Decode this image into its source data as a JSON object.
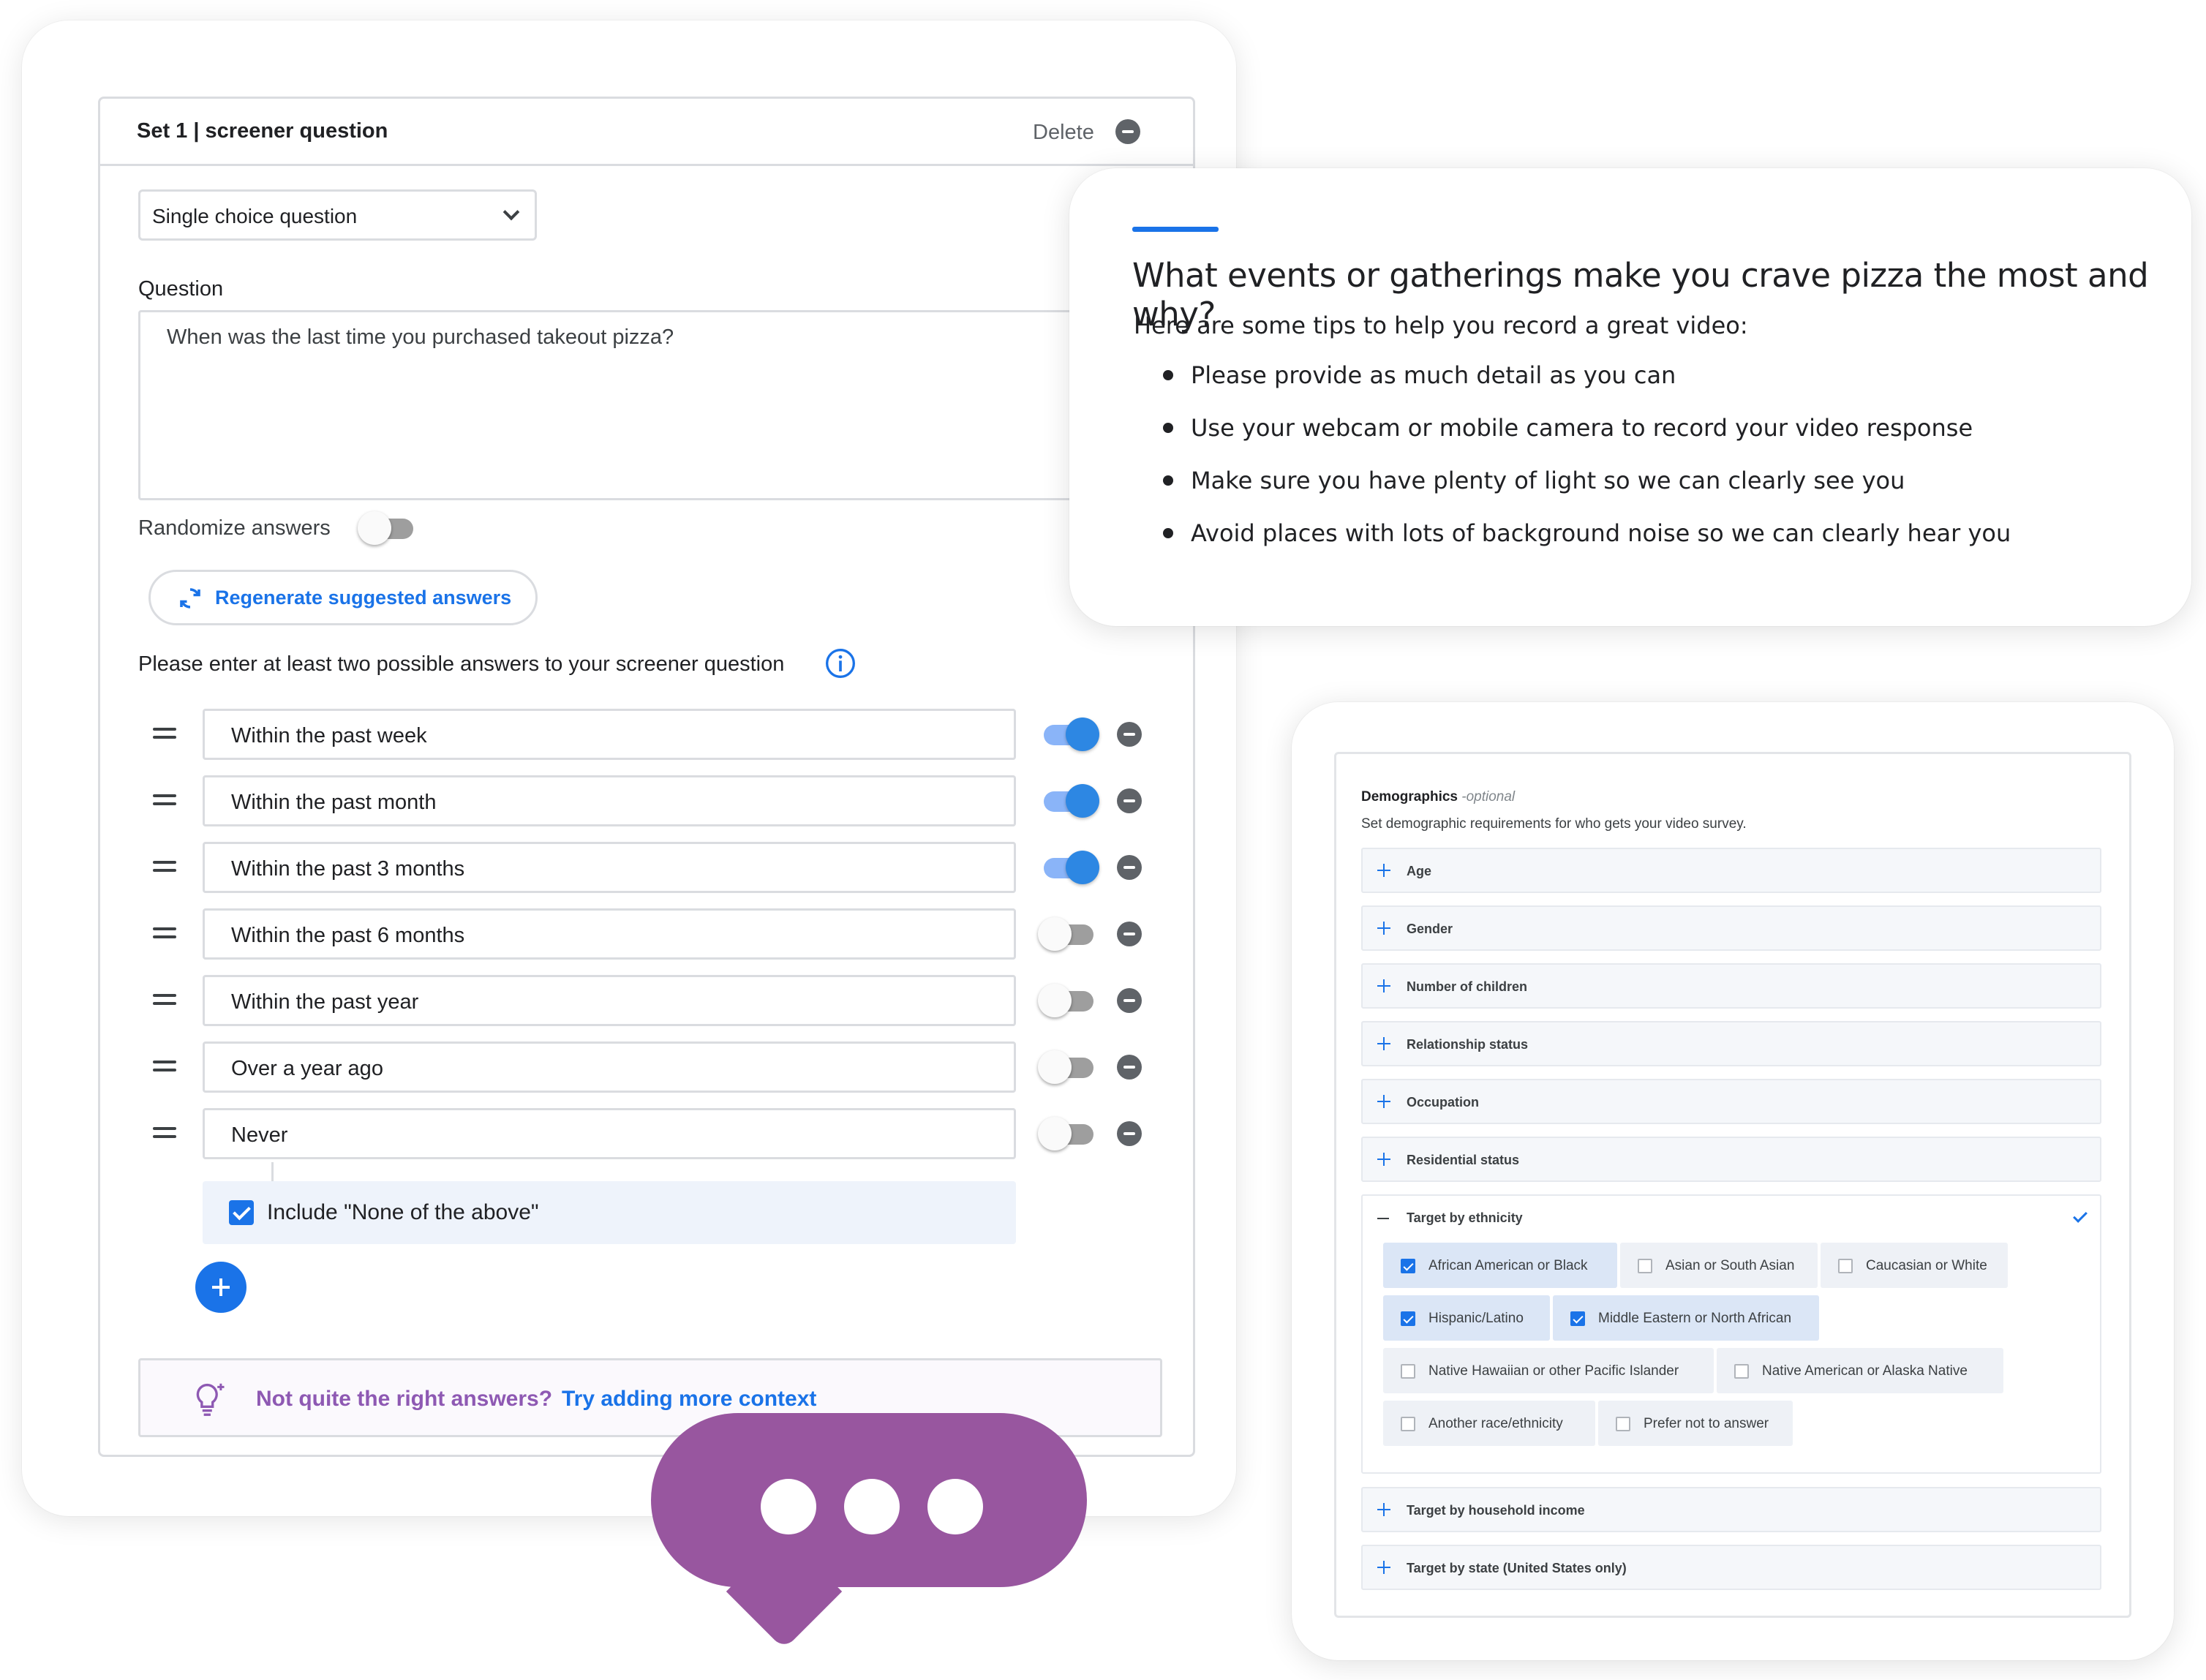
{
  "screener": {
    "set_title": "Set 1 | screener question",
    "delete_label": "Delete",
    "question_type": "Single choice question",
    "question_label": "Question",
    "question_text": "When was the last time you purchased takeout pizza?",
    "randomize_label": "Randomize answers",
    "randomize_on": false,
    "regenerate_label": "Regenerate suggested answers",
    "instruction": "Please enter at least two possible answers to your screener question",
    "answers": [
      {
        "text": "Within the past week",
        "enabled": true
      },
      {
        "text": "Within the past month",
        "enabled": true
      },
      {
        "text": "Within the past 3 months",
        "enabled": true
      },
      {
        "text": "Within the past 6 months",
        "enabled": false
      },
      {
        "text": "Within the past year",
        "enabled": false
      },
      {
        "text": "Over a year ago",
        "enabled": false
      },
      {
        "text": "Never",
        "enabled": false
      }
    ],
    "none_of_above_label": "Include \"None of the above\"",
    "none_of_above_checked": true,
    "context_question": "Not quite the right answers?",
    "context_link": "Try adding more context"
  },
  "tips": {
    "question": "What events or gatherings make you crave pizza the most and why?",
    "intro": "Here are some tips to help you record a great video:",
    "items": [
      "Please provide as much detail as you can",
      "Use your webcam or mobile camera to record your video response",
      "Make sure you have plenty of light so we can clearly see you",
      "Avoid places with lots of background noise so we can clearly hear you"
    ]
  },
  "demographics": {
    "title": "Demographics",
    "optional": "-optional",
    "subtitle": "Set demographic requirements for who gets your video survey.",
    "sections_top": [
      "Age",
      "Gender",
      "Number of children",
      "Relationship status",
      "Occupation",
      "Residential status"
    ],
    "ethnicity_label": "Target by ethnicity",
    "ethnicity_options": [
      {
        "label": "African American or Black",
        "checked": true
      },
      {
        "label": "Asian or South Asian",
        "checked": false
      },
      {
        "label": "Caucasian or White",
        "checked": false
      },
      {
        "label": "Hispanic/Latino",
        "checked": true
      },
      {
        "label": "Middle Eastern or North African",
        "checked": true
      },
      {
        "label": "Native Hawaiian or other Pacific Islander",
        "checked": false
      },
      {
        "label": "Native American or Alaska Native",
        "checked": false
      },
      {
        "label": "Another race/ethnicity",
        "checked": false
      },
      {
        "label": "Prefer not to answer",
        "checked": false
      }
    ],
    "sections_bottom": [
      "Target by household income",
      "Target by state (United States only)"
    ]
  },
  "colors": {
    "accent_blue": "#1a73e8",
    "bubble_purple": "#98569f",
    "context_purple": "#8e59b3"
  },
  "icons": [
    "minus-circle-icon",
    "chevron-down-icon",
    "refresh-icon",
    "info-icon",
    "drag-handle-icon",
    "plus-icon",
    "lightbulb-icon",
    "check-icon"
  ]
}
